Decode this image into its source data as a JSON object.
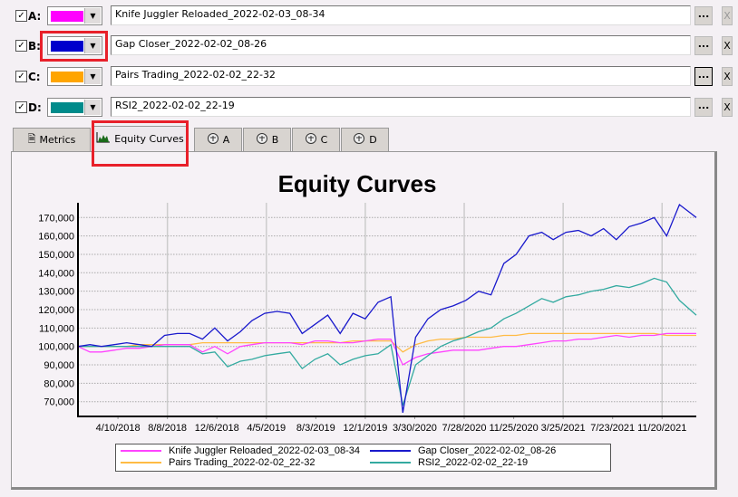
{
  "strategies": [
    {
      "letter": "A:",
      "checked": true,
      "color": "#ff00ff",
      "name": "Knife Juggler Reloaded_2022-02-03_08-34",
      "browse": "...",
      "remove": "X",
      "remove_enabled": false
    },
    {
      "letter": "B:",
      "checked": true,
      "color": "#0000cc",
      "name": "Gap Closer_2022-02-02_08-26",
      "browse": "...",
      "remove": "X",
      "remove_enabled": true
    },
    {
      "letter": "C:",
      "checked": true,
      "color": "#ffa500",
      "name": "Pairs Trading_2022-02-02_22-32",
      "browse": "...",
      "remove": "X",
      "remove_enabled": true
    },
    {
      "letter": "D:",
      "checked": true,
      "color": "#008b8b",
      "name": "RSI2_2022-02-02_22-19",
      "browse": "...",
      "remove": "X",
      "remove_enabled": true
    }
  ],
  "tabs": [
    {
      "label": "Metrics",
      "icon": "document-icon"
    },
    {
      "label": "Equity Curves",
      "icon": "area-chart-icon",
      "active": true
    },
    {
      "label": "A",
      "icon": "brain-icon"
    },
    {
      "label": "B",
      "icon": "brain-icon"
    },
    {
      "label": "C",
      "icon": "brain-icon"
    },
    {
      "label": "D",
      "icon": "brain-icon"
    }
  ],
  "chart_data": {
    "type": "line",
    "title": "Equity Curves",
    "xlabel": "",
    "ylabel": "",
    "values_in_thousands": true,
    "xlim": [
      "2018-01-03",
      "2022-02-11"
    ],
    "ylim": [
      62,
      178
    ],
    "yticks": [
      70,
      80,
      90,
      100,
      110,
      120,
      130,
      140,
      150,
      160,
      170
    ],
    "ytick_labels": [
      "70,000",
      "80,000",
      "90,000",
      "100,000",
      "110,000",
      "120,000",
      "130,000",
      "140,000",
      "150,000",
      "160,000",
      "170,000"
    ],
    "xticks": [
      "2018-04-10",
      "2018-08-08",
      "2018-12-06",
      "2019-04-05",
      "2019-08-03",
      "2019-12-01",
      "2020-03-30",
      "2020-07-28",
      "2020-11-25",
      "2021-03-25",
      "2021-07-23",
      "2021-11-20"
    ],
    "xtick_labels": [
      "4/10/2018",
      "8/8/2018",
      "12/6/2018",
      "4/5/2019",
      "8/3/2019",
      "12/1/2019",
      "3/30/2020",
      "7/28/2020",
      "11/25/2020",
      "3/25/2021",
      "7/23/2021",
      "11/20/2021"
    ],
    "legend_position": "bottom",
    "x_start": "2018-01",
    "x_step": "month",
    "series": [
      {
        "name": "Knife Juggler Reloaded_2022-02-03_08-34",
        "color": "#ff44ff",
        "values": [
          100,
          97,
          97,
          98,
          99,
          99,
          100,
          101,
          101,
          101,
          97,
          100,
          96,
          100,
          101,
          102,
          102,
          102,
          101,
          103,
          103,
          102,
          102,
          103,
          104,
          104,
          90,
          94,
          96,
          97,
          98,
          98,
          98,
          99,
          100,
          100,
          101,
          102,
          103,
          103,
          104,
          104,
          105,
          106,
          105,
          106,
          106,
          107,
          107,
          107
        ]
      },
      {
        "name": "Gap Closer_2022-02-02_08-26",
        "color": "#1a1acc",
        "values": [
          100,
          101,
          100,
          101,
          102,
          101,
          100,
          106,
          107,
          107,
          104,
          110,
          103,
          108,
          114,
          118,
          119,
          118,
          107,
          112,
          117,
          107,
          118,
          115,
          124,
          127,
          64,
          105,
          115,
          120,
          122,
          125,
          130,
          128,
          145,
          150,
          160,
          162,
          158,
          162,
          163,
          160,
          164,
          158,
          165,
          167,
          170,
          160,
          177,
          170
        ]
      },
      {
        "name": "Pairs Trading_2022-02-02_22-32",
        "color": "#ffbb44",
        "values": [
          100,
          100,
          100,
          100,
          100,
          101,
          101,
          101,
          101,
          101,
          102,
          102,
          102,
          102,
          102,
          102,
          102,
          102,
          102,
          102,
          102,
          102,
          103,
          103,
          103,
          103,
          97,
          101,
          103,
          104,
          104,
          105,
          105,
          105,
          106,
          106,
          107,
          107,
          107,
          107,
          107,
          107,
          107,
          107,
          107,
          107,
          107,
          106,
          106,
          106
        ]
      },
      {
        "name": "RSI2_2022-02-02_22-19",
        "color": "#33aaa0",
        "values": [
          100,
          100,
          100,
          100,
          100,
          100,
          100,
          100,
          100,
          100,
          96,
          97,
          89,
          92,
          93,
          95,
          96,
          97,
          88,
          93,
          96,
          90,
          93,
          95,
          96,
          101,
          68,
          90,
          95,
          100,
          103,
          105,
          108,
          110,
          115,
          118,
          122,
          126,
          124,
          127,
          128,
          130,
          131,
          133,
          132,
          134,
          137,
          135,
          125,
          117
        ]
      }
    ]
  }
}
